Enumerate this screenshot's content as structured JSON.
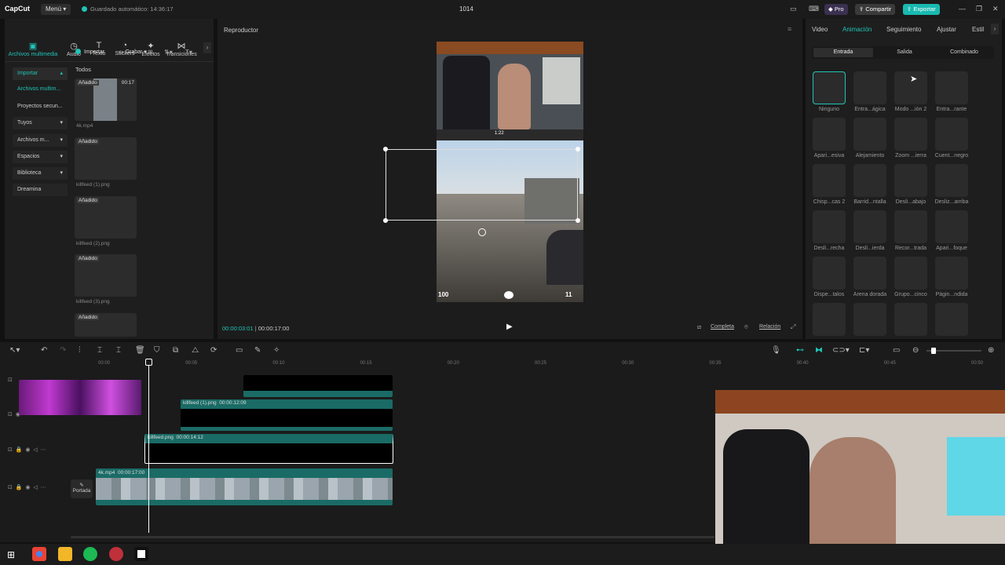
{
  "app": {
    "brand": "CapCut",
    "menu": "Menú",
    "autosave": "Guardado automático: 14:36:17",
    "project_name": "1014",
    "pro": "Pro",
    "share": "Compartir",
    "export": "Exportar"
  },
  "tool_tabs": [
    {
      "label": "Archivos multimedia",
      "icon": "media-icon"
    },
    {
      "label": "Audio",
      "icon": "audio-icon"
    },
    {
      "label": "Texto",
      "icon": "text-icon"
    },
    {
      "label": "Stickers",
      "icon": "sticker-icon"
    },
    {
      "label": "Efectos",
      "icon": "effects-icon"
    },
    {
      "label": "Transiciones",
      "icon": "transitions-icon"
    }
  ],
  "sidebar": {
    "items": [
      "Importar",
      "Archivos multim...",
      "Proyectos secun...",
      "Tuyos",
      "Archivos m...",
      "Espacios",
      "Biblioteca",
      "Dreamina"
    ]
  },
  "media": {
    "import": "Importar",
    "record": "Grabar",
    "all": "Todos",
    "items": [
      {
        "badge": "Añadido",
        "duration": "00:17",
        "name": "4k.mp4"
      },
      {
        "badge": "Añadido",
        "duration": "",
        "name": "killfeed (1).png"
      },
      {
        "badge": "Añadido",
        "duration": "",
        "name": "killfeed (2).png"
      },
      {
        "badge": "Añadido",
        "duration": "",
        "name": "killfeed (3).png"
      },
      {
        "badge": "Añadido",
        "duration": "",
        "name": ""
      }
    ]
  },
  "player": {
    "title": "Reproductor",
    "current_time": "00:00:03:01",
    "total_time": "00:00:17:00",
    "full": "Completa",
    "ratio": "Relación",
    "hud_timer": "1:22",
    "hud_health": "100",
    "hud_ammo": "11"
  },
  "inspector": {
    "tabs": [
      "Video",
      "Animación",
      "Seguimiento",
      "Ajustar",
      "Estil"
    ],
    "subtabs": [
      "Entrada",
      "Salida",
      "Combinado"
    ],
    "animations": [
      "Ninguno",
      "Entra...ágica",
      "Modo ...ión 2",
      "Entra...rante",
      "Apari...esiva",
      "Alejamiento",
      "Zoom ...ierra",
      "Cuent...negro",
      "Chisp...cas 2",
      "Barrid...ntalla",
      "Desli...abajo",
      "Desliz...arriba",
      "Desli...recha",
      "Desli...ierda",
      "Recor...trada",
      "Apari...foque",
      "Dispe...talos",
      "Arena dorada",
      "Grupo...cinco",
      "Págin...ndida",
      "",
      "",
      "",
      ""
    ]
  },
  "timeline": {
    "ruler": [
      "00:00",
      "00:05",
      "00:10",
      "00:15",
      "00:20",
      "00:25",
      "00:30",
      "00:35",
      "00:40",
      "00:45",
      "00:50"
    ],
    "clip_killfeed1": "killfeed (1).png",
    "clip_killfeed1_dur": "00:00:12:09",
    "clip_killfeed": "killfeed.png",
    "clip_killfeed_dur": "00:00:14:12",
    "clip_main": "4k.mp4",
    "clip_main_dur": "00:00:17:00",
    "cover": "Portada"
  },
  "colors": {
    "accent": "#20c4b8",
    "clip": "#1a6b66",
    "export": "#19b9b0"
  }
}
